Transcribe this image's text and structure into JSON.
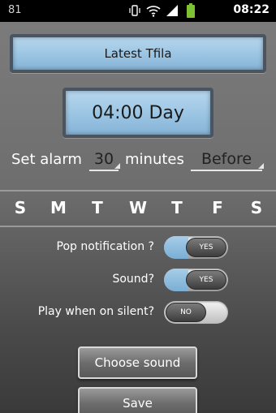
{
  "statusbar": {
    "left_text": "81",
    "time": "08:22",
    "icons": [
      "vibrate-icon",
      "wifi-icon",
      "signal-icon",
      "battery-icon"
    ]
  },
  "header": {
    "title": "Latest Tfila"
  },
  "time_display": {
    "value": "04:00 Day"
  },
  "alarm": {
    "prefix": "Set alarm",
    "minutes_value": "30",
    "middle": "minutes",
    "relation_value": "Before"
  },
  "days": [
    "S",
    "M",
    "T",
    "W",
    "T",
    "F",
    "S"
  ],
  "options": [
    {
      "label": "Pop notification ?",
      "state": "YES"
    },
    {
      "label": "Sound?",
      "state": "YES"
    },
    {
      "label": "Play when on silent?",
      "state": "NO"
    }
  ],
  "buttons": {
    "choose_sound": "Choose sound",
    "save": "Save"
  },
  "colors": {
    "lcd": "#9dc6e4",
    "toggle_on": "#8fbfe0",
    "background": "#6e6e6e"
  }
}
